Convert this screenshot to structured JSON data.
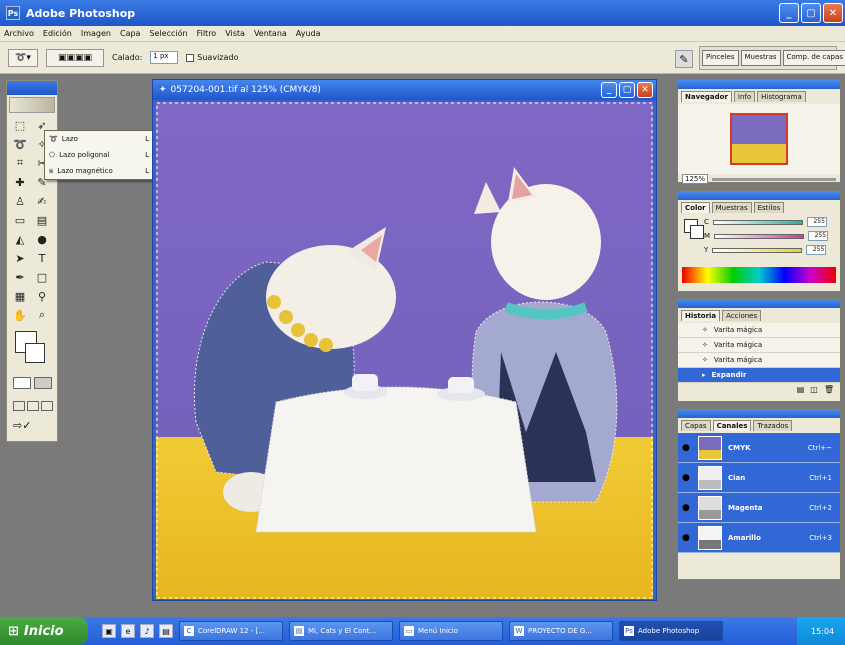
{
  "window": {
    "title": "Adobe Photoshop"
  },
  "menu": [
    "Archivo",
    "Edición",
    "Imagen",
    "Capa",
    "Selección",
    "Filtro",
    "Vista",
    "Ventana",
    "Ayuda"
  ],
  "options": {
    "calado_label": "Calado:",
    "calado_value": "1 px",
    "suavizado_label": "Suavizado"
  },
  "dock": [
    "Pinceles",
    "Muestras",
    "Comp. de capas"
  ],
  "document": {
    "title": "057204-001.tif al 125% (CMYK/8)"
  },
  "flyout": [
    {
      "label": "Lazo",
      "key": "L"
    },
    {
      "label": "Lazo poligonal",
      "key": "L"
    },
    {
      "label": "Lazo magnético",
      "key": "L"
    }
  ],
  "navigator": {
    "tabs": [
      "Navegador",
      "Info",
      "Histograma"
    ],
    "zoom": "125%"
  },
  "color_panel": {
    "tabs": [
      "Color",
      "Muestras",
      "Estilos"
    ],
    "channels": [
      {
        "name": "C",
        "value": "255",
        "color": "#27b0a4"
      },
      {
        "name": "M",
        "value": "255",
        "color": "#c83ca0"
      },
      {
        "name": "Y",
        "value": "255",
        "color": "#e8d22a"
      }
    ]
  },
  "history": {
    "tabs": [
      "Historia",
      "Acciones"
    ],
    "items": [
      {
        "label": "Varita mágica",
        "selected": false
      },
      {
        "label": "Varita mágica",
        "selected": false
      },
      {
        "label": "Varita mágica",
        "selected": false
      },
      {
        "label": "Expandir",
        "selected": true
      }
    ]
  },
  "channels": {
    "tabs": [
      "Capas",
      "Canales",
      "Trazados"
    ],
    "items": [
      {
        "label": "CMYK",
        "shortcut": "Ctrl+~"
      },
      {
        "label": "Cian",
        "shortcut": "Ctrl+1"
      },
      {
        "label": "Magenta",
        "shortcut": "Ctrl+2"
      },
      {
        "label": "Amarillo",
        "shortcut": "Ctrl+3"
      }
    ]
  },
  "taskbar": {
    "start": "Inicio",
    "tasks": [
      {
        "label": "CorelDRAW 12 - [...",
        "active": false
      },
      {
        "label": "Mi, Cats y El Cont...",
        "active": false
      },
      {
        "label": "Menú Inicio",
        "active": false
      },
      {
        "label": "PROYECTO DE G...",
        "active": false
      },
      {
        "label": "Adobe Photoshop",
        "active": true
      }
    ],
    "clock": "15:04"
  }
}
